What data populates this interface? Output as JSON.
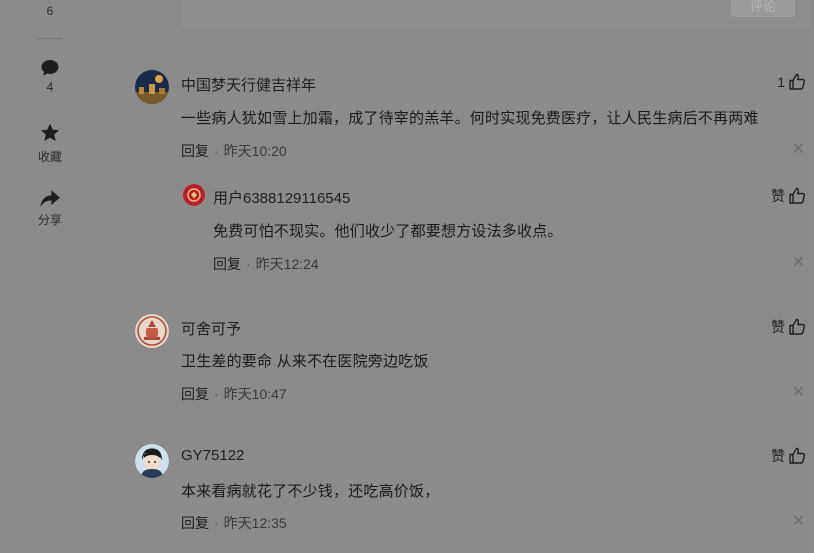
{
  "rail": {
    "top_count": "6",
    "comment_count": "4",
    "favorite_label": "收藏",
    "share_label": "分享"
  },
  "composer": {
    "submit_label": "评论"
  },
  "comments": [
    {
      "username": "中国梦天行健吉祥年",
      "text": "一些病人犹如雪上加霜，成了待宰的羔羊。何时实现免费医疗，让人民生病后不再两难",
      "reply_label": "回复",
      "time": "昨天10:20",
      "like": "1"
    },
    {
      "username": "用户6388129116545",
      "text": "免费可怕不现实。他们收少了都要想方设法多收点。",
      "reply_label": "回复",
      "time": "昨天12:24",
      "like": "赞"
    },
    {
      "username": "可舍可予",
      "text": "卫生差的要命 从来不在医院旁边吃饭",
      "reply_label": "回复",
      "time": "昨天10:47",
      "like": "赞"
    },
    {
      "username": "GY75122",
      "text": "本来看病就花了不少钱，还吃高价饭，",
      "reply_label": "回复",
      "time": "昨天12:35",
      "like": "赞"
    }
  ],
  "separator": "·",
  "close_glyph": "✕",
  "colors": {
    "overlay_bg": "#8b8b8b",
    "text": "#1c1c1c"
  }
}
